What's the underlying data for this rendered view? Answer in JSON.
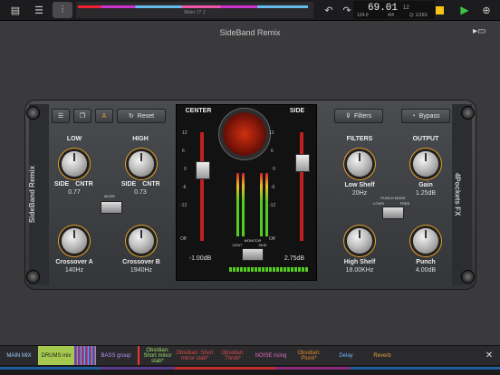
{
  "topbar": {
    "icons": [
      "sidebar-icon",
      "list-icon",
      "mixer-icon"
    ],
    "timeline_label": "Slider 77 1'",
    "counter_main": "69.01",
    "counter_sub": "12",
    "counter_bpm": "124.0",
    "counter_sig": "4/4",
    "counter_grid": "Q: 1/16S",
    "undo_label": "↶",
    "redo_label": "↷"
  },
  "window": {
    "title": "SideBand Remix"
  },
  "plugin": {
    "left_name": "SideBand Remix",
    "right_name": "4Pockets FX",
    "reset_label": "Reset",
    "filters_label": "Filters",
    "bypass_label": "Bypass",
    "low": {
      "title": "LOW",
      "side": "SIDE",
      "cntr": "CNTR",
      "value": "0.77"
    },
    "high": {
      "title": "HIGH",
      "side": "SIDE",
      "cntr": "CNTR",
      "value": "0.73"
    },
    "mode_label": "MODE",
    "crossover_a": {
      "label": "Crossover A",
      "value": "140Hz"
    },
    "crossover_b": {
      "label": "Crossover B",
      "value": "1940Hz"
    },
    "center": {
      "title": "CENTER",
      "value": "-1.00dB"
    },
    "side": {
      "title": "SIDE",
      "value": "2.75dB"
    },
    "monitor_label": "MONITOR",
    "monitor_opts": [
      "CENT",
      "SIDE"
    ],
    "scale": [
      "12",
      "6",
      "0",
      "-6",
      "-12",
      "Off"
    ],
    "filters": {
      "title": "FILTERS"
    },
    "output": {
      "title": "OUTPUT"
    },
    "low_shelf": {
      "label": "Low Shelf",
      "value": "20Hz"
    },
    "gain": {
      "label": "Gain",
      "value": "1.25dB"
    },
    "punch_mode": "PUNCH MODE",
    "punch_opts": [
      "LOWS",
      "FREE"
    ],
    "high_shelf": {
      "label": "High Shelf",
      "value": "18.00KHz"
    },
    "punch": {
      "label": "Punch",
      "value": "4.00dB"
    }
  },
  "tabs": [
    {
      "label": "MAIN MIX",
      "color": "#1f4a7a"
    },
    {
      "label": "DRUMS mix",
      "color": "#9cc04a"
    },
    {
      "label": "BASS group",
      "color": "#5a3a8a"
    },
    {
      "label": "Obsidian: Short minor stab*",
      "color": "#2a2a2c"
    },
    {
      "label": "Obsidian: Short minor stab*",
      "color": "#2a2a2c"
    },
    {
      "label": "Obsidian: Throb*",
      "color": "#2a2a2c"
    },
    {
      "label": "NOISE rising",
      "color": "#2a2a2c"
    },
    {
      "label": "Obsidian: Plunk*",
      "color": "#2a2a2c"
    },
    {
      "label": "Delay",
      "color": "#2a2a2c"
    },
    {
      "label": "Reverb",
      "color": "#2a2a2c"
    }
  ],
  "close_label": "✕"
}
